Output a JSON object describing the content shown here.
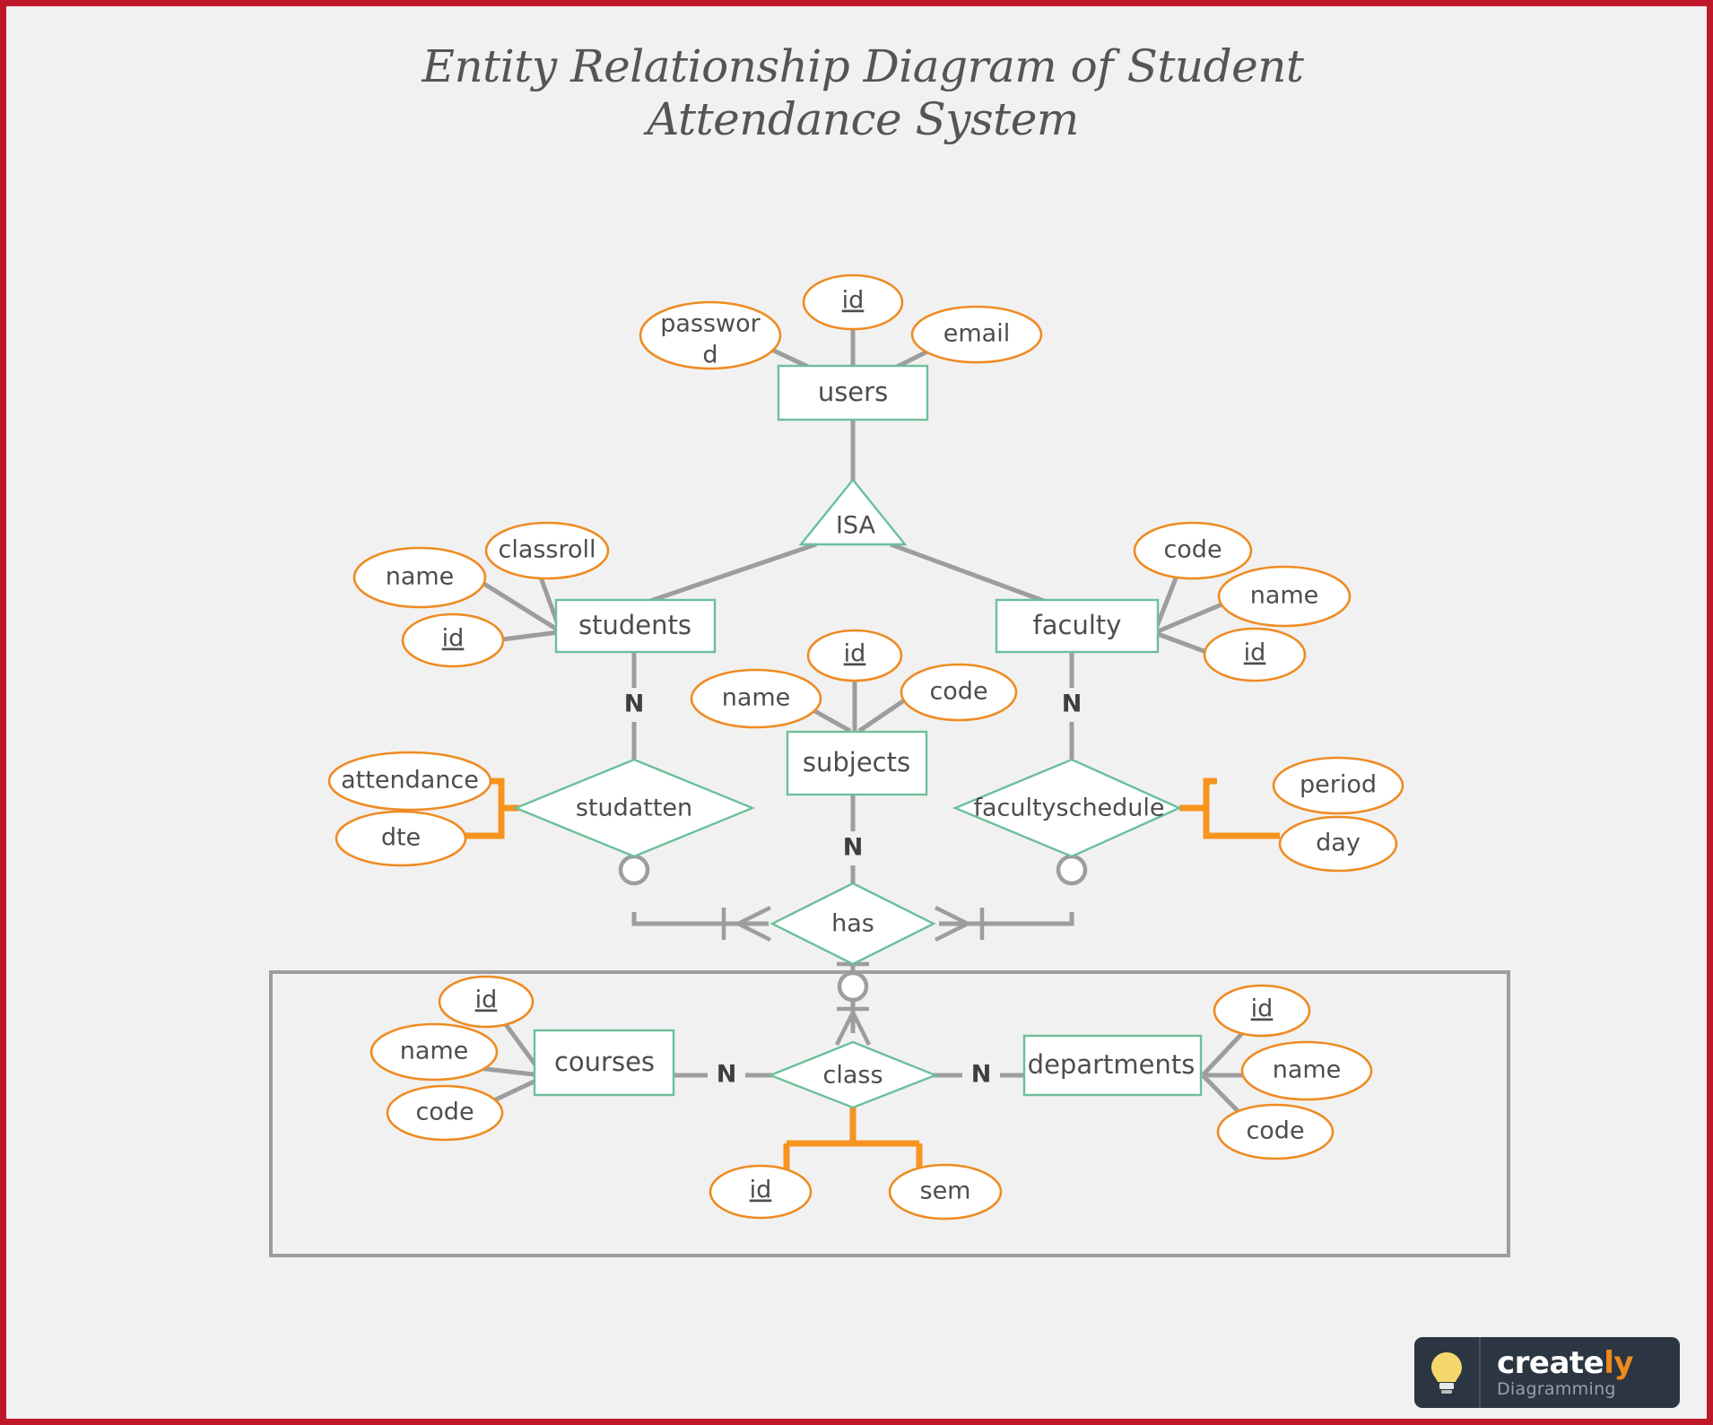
{
  "page": {
    "title_line1": "Entity Relationship Diagram of Student",
    "title_line2": "Attendance System",
    "background_color": "#f1f1f1",
    "border_color": "#c0182b",
    "entity_border_color": "#6cbf9a",
    "attribute_border_color": "#ef8b22",
    "connector_color": "#9d9d9d",
    "orange_connector_color": "#f7941e"
  },
  "entities": [
    {
      "id": "users",
      "label": "users"
    },
    {
      "id": "students",
      "label": "students"
    },
    {
      "id": "faculty",
      "label": "faculty"
    },
    {
      "id": "subjects",
      "label": "subjects"
    },
    {
      "id": "courses",
      "label": "courses"
    },
    {
      "id": "departments",
      "label": "departments"
    }
  ],
  "relationships": [
    {
      "id": "isa",
      "label": "ISA",
      "shape": "triangle"
    },
    {
      "id": "studatten",
      "label": "studatten",
      "shape": "diamond"
    },
    {
      "id": "facultyschedule",
      "label": "facultyschedule",
      "shape": "diamond"
    },
    {
      "id": "has",
      "label": "has",
      "shape": "diamond"
    },
    {
      "id": "class",
      "label": "class",
      "shape": "diamond"
    }
  ],
  "attributes": {
    "users": [
      {
        "label": "password",
        "line1": "passwor",
        "line2": "d",
        "primary_key": false
      },
      {
        "label": "id",
        "primary_key": true
      },
      {
        "label": "email",
        "primary_key": false
      }
    ],
    "students": [
      {
        "label": "name",
        "primary_key": false
      },
      {
        "label": "classroll",
        "primary_key": false
      },
      {
        "label": "id",
        "primary_key": true
      }
    ],
    "faculty": [
      {
        "label": "code",
        "primary_key": false
      },
      {
        "label": "name",
        "primary_key": false
      },
      {
        "label": "id",
        "primary_key": true
      }
    ],
    "subjects": [
      {
        "label": "id",
        "primary_key": true
      },
      {
        "label": "name",
        "primary_key": false
      },
      {
        "label": "code",
        "primary_key": false
      }
    ],
    "studatten": [
      {
        "label": "attendance",
        "primary_key": false
      },
      {
        "label": "dte",
        "primary_key": false
      }
    ],
    "facultyschedule": [
      {
        "label": "period",
        "primary_key": false
      },
      {
        "label": "day",
        "primary_key": false
      }
    ],
    "courses": [
      {
        "label": "id",
        "primary_key": true
      },
      {
        "label": "name",
        "primary_key": false
      },
      {
        "label": "code",
        "primary_key": false
      }
    ],
    "class": [
      {
        "label": "id",
        "primary_key": true
      },
      {
        "label": "sem",
        "primary_key": false
      }
    ],
    "departments": [
      {
        "label": "id",
        "primary_key": true
      },
      {
        "label": "name",
        "primary_key": false
      },
      {
        "label": "code",
        "primary_key": false
      }
    ]
  },
  "cardinalities": [
    {
      "id": "students-studatten",
      "label": "N"
    },
    {
      "id": "faculty-facultyschedule",
      "label": "N"
    },
    {
      "id": "subjects-has",
      "label": "N"
    },
    {
      "id": "courses-class",
      "label": "N"
    },
    {
      "id": "class-departments",
      "label": "N"
    }
  ],
  "logo": {
    "brand_prefix": "create",
    "brand_suffix": "ly",
    "tagline": "Diagramming",
    "icon": "lightbulb-icon",
    "background_color": "#2b3642",
    "accent_color": "#f08a1d"
  }
}
